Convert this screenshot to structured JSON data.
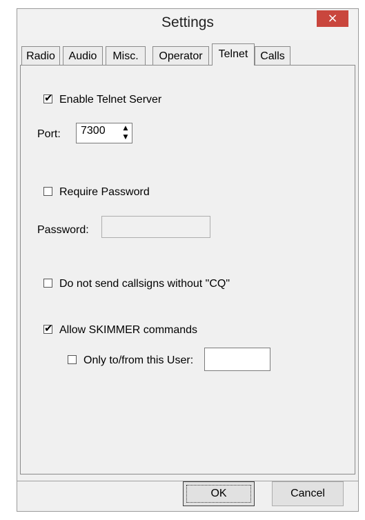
{
  "window": {
    "title": "Settings",
    "close_glyph": "×"
  },
  "tabs": [
    {
      "label": "Radio",
      "active": false
    },
    {
      "label": "Audio",
      "active": false
    },
    {
      "label": "Misc.",
      "active": false
    },
    {
      "label": "Operator",
      "active": false
    },
    {
      "label": "Telnet",
      "active": true
    },
    {
      "label": "Calls",
      "active": false
    }
  ],
  "telnet": {
    "enable_server": {
      "label": "Enable Telnet Server",
      "checked": true
    },
    "port": {
      "label": "Port:",
      "value": "7300"
    },
    "require_password": {
      "label": "Require Password",
      "checked": false
    },
    "password": {
      "label": "Password:",
      "value": ""
    },
    "no_callsigns_without_cq": {
      "label": "Do not send callsigns without \"CQ\"",
      "checked": false
    },
    "allow_skimmer": {
      "label": "Allow SKIMMER commands",
      "checked": true
    },
    "only_user": {
      "label": "Only to/from this User:",
      "checked": false,
      "value": ""
    }
  },
  "buttons": {
    "ok": "OK",
    "cancel": "Cancel"
  },
  "icons": {
    "checked": "check-mark-icon",
    "spin_up": "triangle-up-icon",
    "spin_down": "triangle-down-icon"
  }
}
